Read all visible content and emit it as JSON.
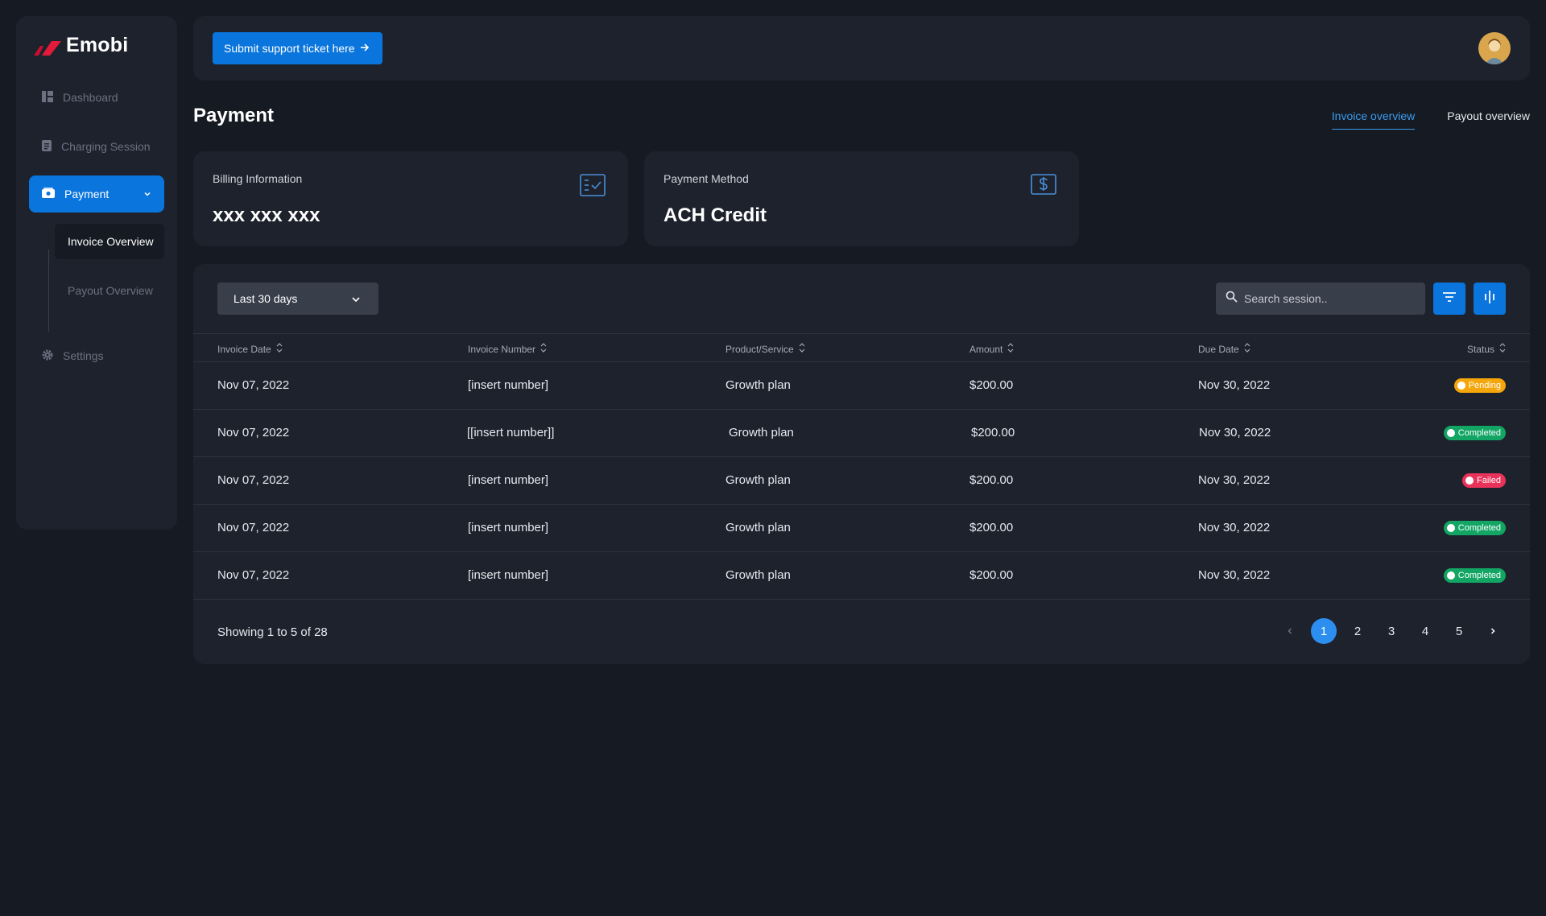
{
  "brand": {
    "name": "Emobi"
  },
  "sidebar": {
    "items": [
      {
        "label": "Dashboard",
        "icon": "dashboard-icon"
      },
      {
        "label": "Charging Session",
        "icon": "document-icon"
      },
      {
        "label": "Payment",
        "icon": "wallet-icon",
        "active": true
      },
      {
        "label": "Settings",
        "icon": "gear-icon"
      }
    ],
    "submenu": [
      {
        "label": "Invoice Overview",
        "active": true
      },
      {
        "label": "Payout Overview"
      }
    ]
  },
  "topbar": {
    "support_label": "Submit support ticket here"
  },
  "page": {
    "title": "Payment",
    "tabs": [
      {
        "label": "Invoice overview",
        "active": true
      },
      {
        "label": "Payout overview"
      }
    ]
  },
  "cards": [
    {
      "label": "Billing Information",
      "value": "xxx xxx xxx",
      "icon": "checklist-icon"
    },
    {
      "label": "Payment Method",
      "value": "ACH Credit",
      "icon": "dollar-icon"
    }
  ],
  "filters": {
    "range": "Last 30 days",
    "search_placeholder": "Search session.."
  },
  "table": {
    "columns": [
      "Invoice Date",
      "Invoice Number",
      "Product/Service",
      "Amount",
      "Due Date",
      "Status"
    ],
    "rows": [
      {
        "date": "Nov 07, 2022",
        "number": "[insert number]",
        "product": "Growth plan",
        "amount": "$200.00",
        "due": "Nov 30, 2022",
        "status": "Pending"
      },
      {
        "date": "Nov 07, 2022",
        "number": "[[insert number]]",
        "product": "Growth plan",
        "amount": "$200.00",
        "due": "Nov 30, 2022",
        "status": "Completed"
      },
      {
        "date": "Nov 07, 2022",
        "number": "[insert number]",
        "product": "Growth plan",
        "amount": "$200.00",
        "due": "Nov 30, 2022",
        "status": "Failed"
      },
      {
        "date": "Nov 07, 2022",
        "number": "[insert number]",
        "product": "Growth plan",
        "amount": "$200.00",
        "due": "Nov 30, 2022",
        "status": "Completed"
      },
      {
        "date": "Nov 07, 2022",
        "number": "[insert number]",
        "product": "Growth plan",
        "amount": "$200.00",
        "due": "Nov 30, 2022",
        "status": "Completed"
      }
    ]
  },
  "pagination": {
    "summary": "Showing 1 to 5 of 28",
    "pages": [
      "1",
      "2",
      "3",
      "4",
      "5"
    ],
    "current": "1"
  },
  "colors": {
    "accent": "#0a75dc",
    "pending": "#f5a60b",
    "completed": "#12a564",
    "failed": "#e8325a"
  }
}
